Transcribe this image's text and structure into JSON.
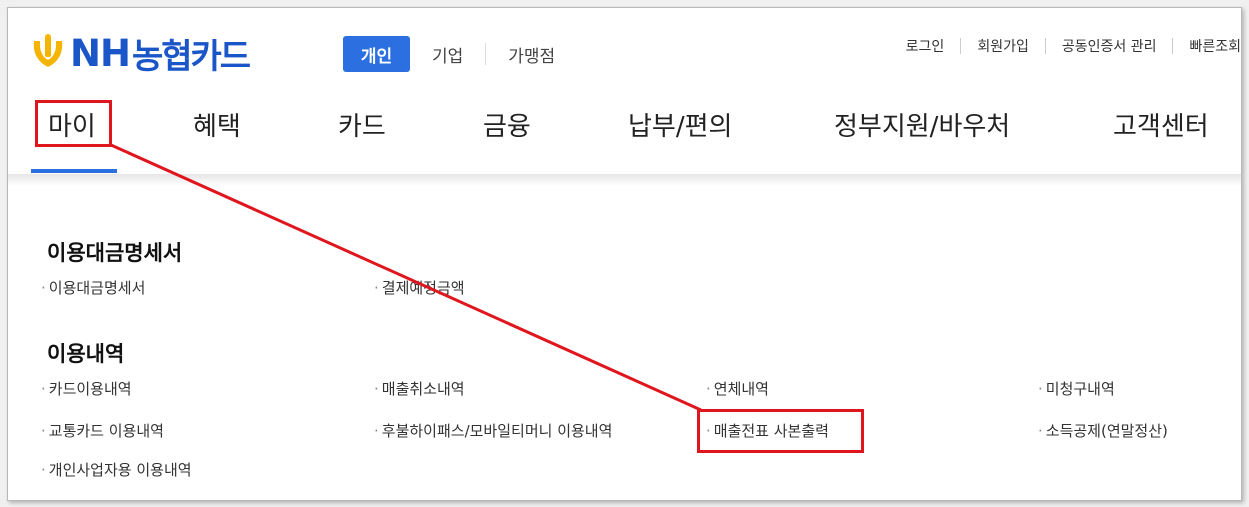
{
  "brand": {
    "name_en": "NH",
    "name_ko": "농협카드",
    "logo_color": "#1a56c8",
    "icon_color": "#f4b400"
  },
  "segments": [
    {
      "label": "개인",
      "active": true
    },
    {
      "label": "기업",
      "active": false
    },
    {
      "label": "가맹점",
      "active": false
    }
  ],
  "util_links": [
    "로그인",
    "회원가입",
    "공동인증서 관리",
    "빠른조회"
  ],
  "gnb": [
    "마이",
    "혜택",
    "카드",
    "금융",
    "납부/편의",
    "정부지원/바우처",
    "고객센터"
  ],
  "sections": [
    {
      "title": "이용대금명세서",
      "links": [
        "이용대금명세서",
        "결제예정금액"
      ]
    },
    {
      "title": "이용내역",
      "links": [
        "카드이용내역",
        "매출취소내역",
        "연체내역",
        "미청구내역",
        "교통카드 이용내역",
        "후불하이패스/모바일티머니 이용내역",
        "매출전표 사본출력",
        "소득공제(연말정산)",
        "개인사업자용 이용내역"
      ]
    }
  ],
  "colors": {
    "accent": "#2b6fe0",
    "highlight": "#e0161e"
  }
}
